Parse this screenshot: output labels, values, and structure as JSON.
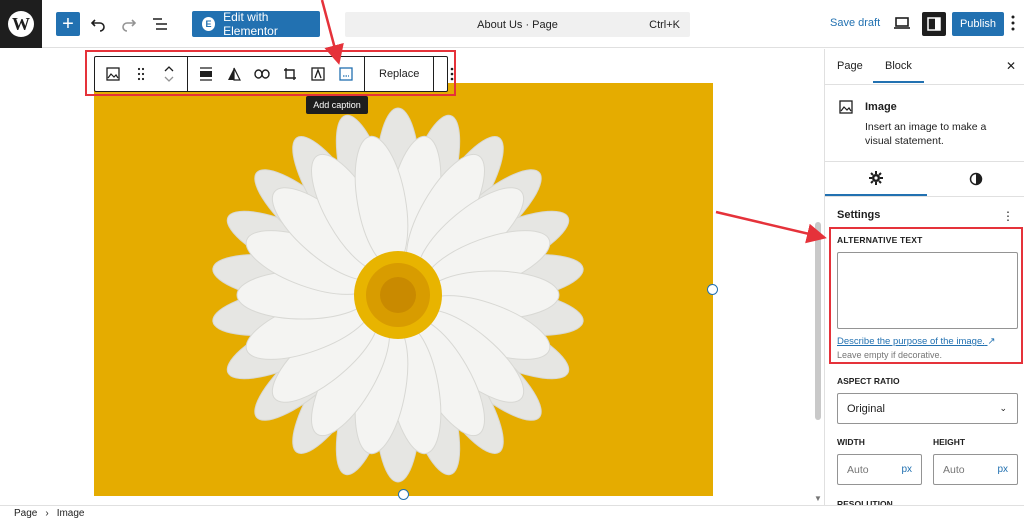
{
  "topbar": {
    "add_icon": "plus-icon",
    "undo_icon": "undo-icon",
    "redo_icon": "redo-icon",
    "outline_icon": "list-view-icon",
    "elementor_label": "Edit with Elementor",
    "doc_title": "About Us · Page",
    "shortcut": "Ctrl+K",
    "save_draft": "Save draft",
    "publish": "Publish"
  },
  "block_toolbar": {
    "replace": "Replace",
    "tooltip": "Add caption"
  },
  "sidebar": {
    "tabs": [
      {
        "label": "Page"
      },
      {
        "label": "Block"
      }
    ],
    "block_title": "Image",
    "block_desc": "Insert an image to make a visual statement.",
    "settings_label": "Settings",
    "alt_label": "ALTERNATIVE TEXT",
    "alt_value": "",
    "alt_link": "Describe the purpose of the image.",
    "alt_help": "Leave empty if decorative.",
    "ratio_label": "ASPECT RATIO",
    "ratio_value": "Original",
    "width_label": "WIDTH",
    "height_label": "HEIGHT",
    "width_placeholder": "Auto",
    "height_placeholder": "Auto",
    "unit": "px",
    "resolution_label": "RESOLUTION"
  },
  "breadcrumb": {
    "items": [
      "Page",
      "Image"
    ],
    "separator": "›"
  },
  "colors": {
    "accent": "#2271b1",
    "image_bg": "#e5ac00",
    "annotation": "#e5323a"
  }
}
